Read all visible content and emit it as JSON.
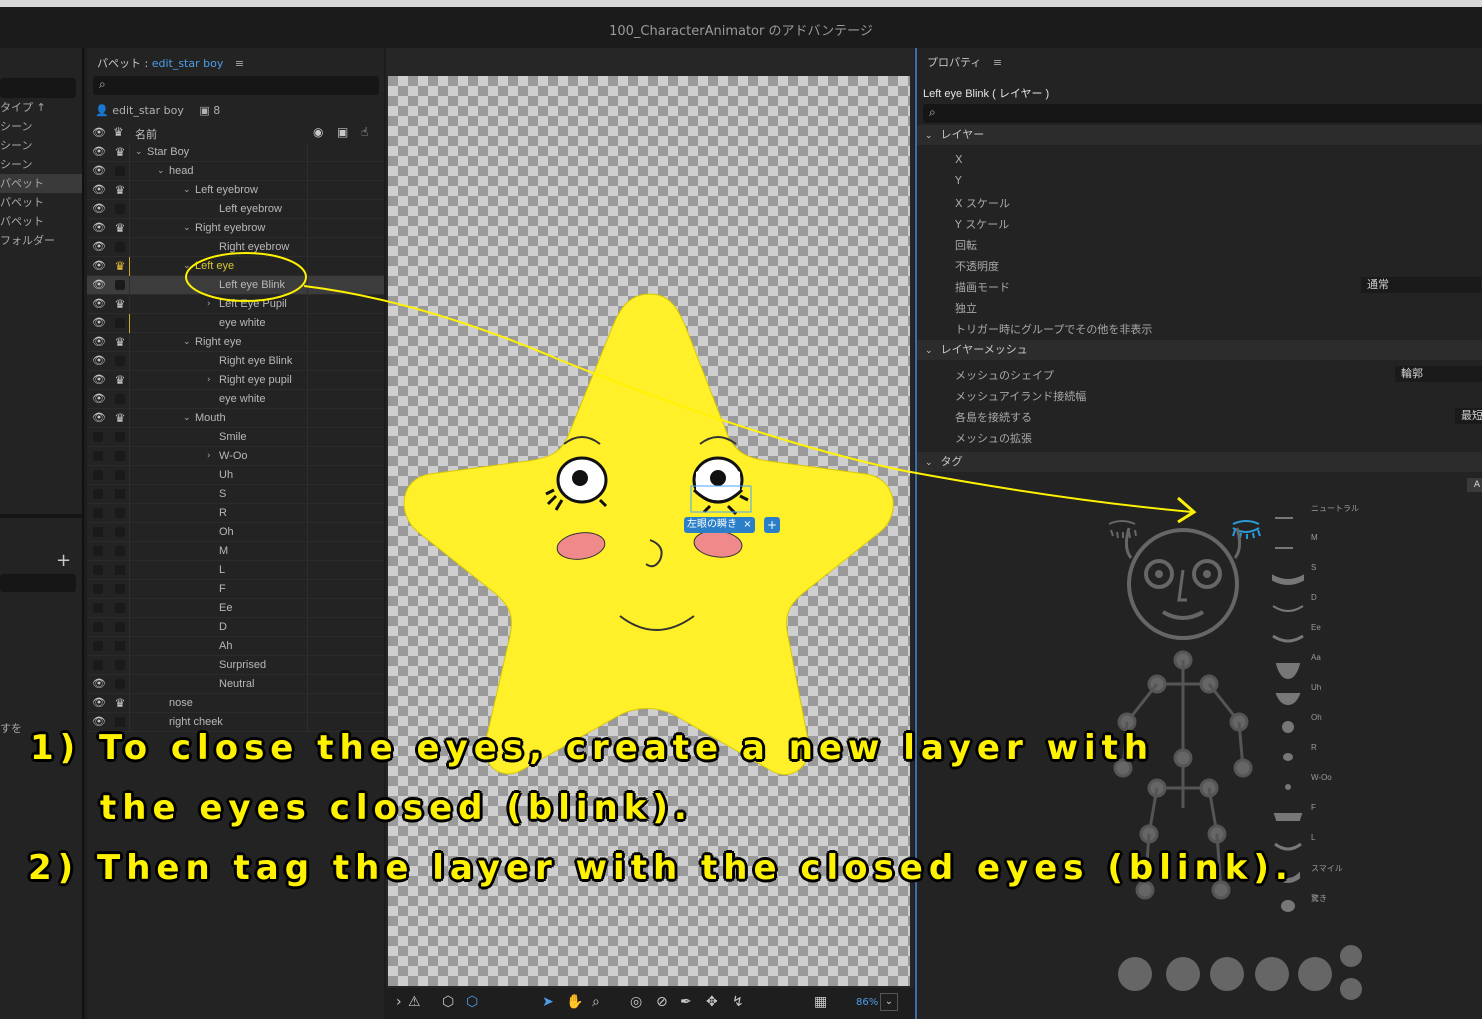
{
  "window": {
    "title": "100_CharacterAnimator のアドバンテージ"
  },
  "left_panel": {
    "items": [
      {
        "label": "タイプ ↑",
        "selected": false
      },
      {
        "label": "シーン",
        "selected": false
      },
      {
        "label": "シーン",
        "selected": false
      },
      {
        "label": "シーン",
        "selected": false
      },
      {
        "label": "パペット",
        "selected": true
      },
      {
        "label": "パペット",
        "selected": false
      },
      {
        "label": "パペット",
        "selected": false
      },
      {
        "label": "フォルダー",
        "selected": false
      }
    ],
    "add_label": "+",
    "fragment_text": "すを"
  },
  "puppet_panel": {
    "title": "パペット :",
    "puppet_name": "edit_star boy",
    "menu_icon": "hamburger-icon",
    "search_icon": "search-icon",
    "info_name": "edit_star boy",
    "info_count": "8",
    "column_name": "名前",
    "layers": [
      {
        "label": "Star Boy",
        "indent": 0,
        "chevron": "v",
        "eye": true,
        "crown": true
      },
      {
        "label": "head",
        "indent": 1,
        "chevron": "v",
        "eye": true,
        "crown": false
      },
      {
        "label": "Left eyebrow",
        "indent": 2,
        "chevron": "v",
        "eye": true,
        "crown": true
      },
      {
        "label": "Left eyebrow",
        "indent": 3,
        "chevron": "",
        "eye": true,
        "crown": false
      },
      {
        "label": "Right eyebrow",
        "indent": 2,
        "chevron": "v",
        "eye": true,
        "crown": true
      },
      {
        "label": "Right eyebrow",
        "indent": 3,
        "chevron": "",
        "eye": true,
        "crown": false
      },
      {
        "label": "Left eye",
        "indent": 2,
        "chevron": "v",
        "eye": true,
        "crown": true,
        "highlight": true
      },
      {
        "label": "Left eye Blink",
        "indent": 3,
        "chevron": "",
        "eye": true,
        "crown": false,
        "selected": true
      },
      {
        "label": "Left Eye Pupil",
        "indent": 3,
        "chevron": ">",
        "eye": true,
        "crown": true
      },
      {
        "label": "eye white",
        "indent": 3,
        "chevron": "",
        "eye": true,
        "crown": false
      },
      {
        "label": "Right eye",
        "indent": 2,
        "chevron": "v",
        "eye": true,
        "crown": true
      },
      {
        "label": "Right eye Blink",
        "indent": 3,
        "chevron": "",
        "eye": true,
        "crown": false
      },
      {
        "label": "Right eye pupil",
        "indent": 3,
        "chevron": ">",
        "eye": true,
        "crown": true
      },
      {
        "label": "eye white",
        "indent": 3,
        "chevron": "",
        "eye": true,
        "crown": false
      },
      {
        "label": "Mouth",
        "indent": 2,
        "chevron": "v",
        "eye": true,
        "crown": true
      },
      {
        "label": "Smile",
        "indent": 3,
        "chevron": "",
        "eye": false,
        "crown": false
      },
      {
        "label": "W-Oo",
        "indent": 3,
        "chevron": ">",
        "eye": false,
        "crown": false
      },
      {
        "label": "Uh",
        "indent": 3,
        "chevron": "",
        "eye": false,
        "crown": false
      },
      {
        "label": "S",
        "indent": 3,
        "chevron": "",
        "eye": false,
        "crown": false
      },
      {
        "label": "R",
        "indent": 3,
        "chevron": "",
        "eye": false,
        "crown": false
      },
      {
        "label": "Oh",
        "indent": 3,
        "chevron": "",
        "eye": false,
        "crown": false
      },
      {
        "label": "M",
        "indent": 3,
        "chevron": "",
        "eye": false,
        "crown": false
      },
      {
        "label": "L",
        "indent": 3,
        "chevron": "",
        "eye": false,
        "crown": false
      },
      {
        "label": "F",
        "indent": 3,
        "chevron": "",
        "eye": false,
        "crown": false
      },
      {
        "label": "Ee",
        "indent": 3,
        "chevron": "",
        "eye": false,
        "crown": false
      },
      {
        "label": "D",
        "indent": 3,
        "chevron": "",
        "eye": false,
        "crown": false
      },
      {
        "label": "Ah",
        "indent": 3,
        "chevron": "",
        "eye": false,
        "crown": false
      },
      {
        "label": "Surprised",
        "indent": 3,
        "chevron": "",
        "eye": false,
        "crown": false
      },
      {
        "label": "Neutral",
        "indent": 3,
        "chevron": "",
        "eye": true,
        "crown": false
      },
      {
        "label": "nose",
        "indent": 1,
        "chevron": "",
        "eye": true,
        "crown": true
      },
      {
        "label": "right cheek",
        "indent": 1,
        "chevron": "",
        "eye": true,
        "crown": false
      }
    ]
  },
  "canvas": {
    "tag_badge": "左眼の瞬き",
    "tag_badge_close": "×",
    "tag_badge_add": "+",
    "zoom": "86%",
    "star_color": "#fff02a",
    "cheek_color": "#f08a8a"
  },
  "properties": {
    "title": "プロパティ",
    "layer_name": "Left eye Blink ( レイヤー )",
    "sections": {
      "layer": "レイヤー",
      "mesh": "レイヤーメッシュ",
      "tags": "タグ"
    },
    "layer_props": [
      "X",
      "Y",
      "X スケール",
      "Y スケール",
      "回転",
      "不透明度",
      "描画モード",
      "独立",
      "トリガー時にグループでその他を非表示"
    ],
    "blend_mode_value": "通常",
    "mesh_props": [
      "メッシュのシェイプ",
      "メッシュアイランド接続幅",
      "各島を接続する",
      "メッシュの拡張"
    ],
    "mesh_shape_value": "輪郭",
    "connect_value": "最短",
    "tag_button": "A",
    "visemes": [
      "ニュートラル",
      "M",
      "S",
      "D",
      "Ee",
      "Aa",
      "Uh",
      "Oh",
      "R",
      "W-Oo",
      "F",
      "L",
      "スマイル",
      "驚き"
    ]
  },
  "annotation": {
    "line1": "1) To close the eyes, create a new layer with",
    "line2": "the eyes closed (blink).",
    "line3": "2) Then tag the layer with the closed eyes (blink).",
    "color": "#fff200"
  }
}
